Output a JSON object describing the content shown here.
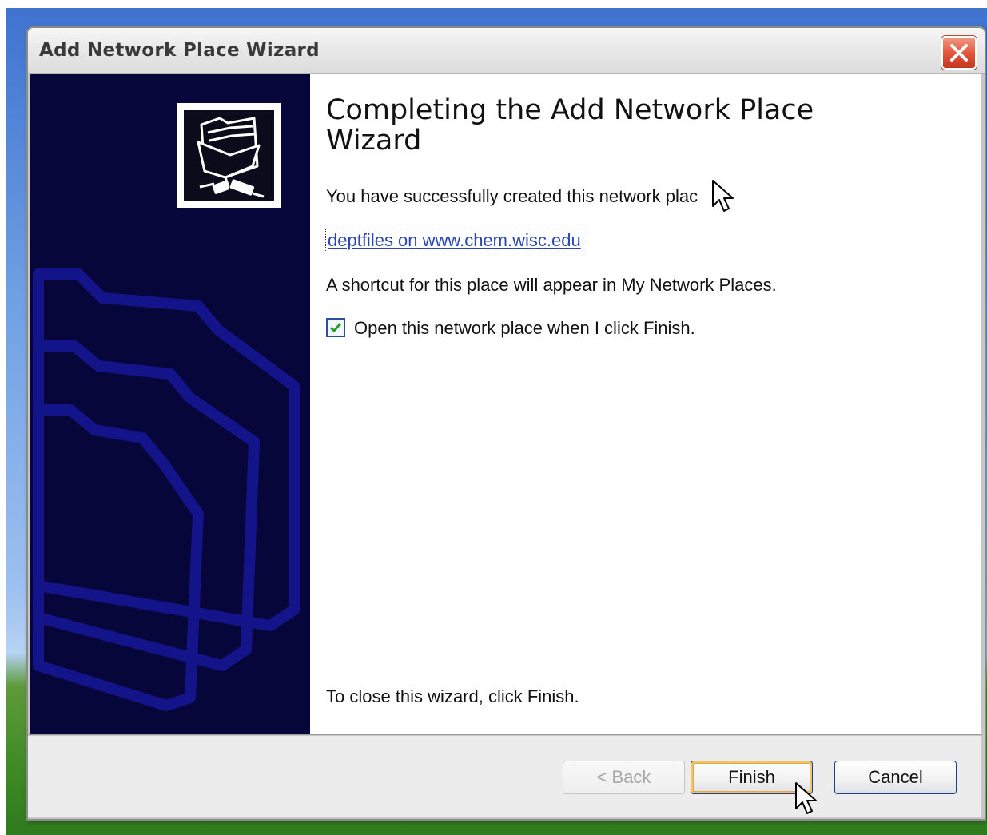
{
  "window": {
    "title": "Add Network Place Wizard"
  },
  "content": {
    "heading": "Completing the Add Network Place Wizard",
    "success_text": "You have successfully created this network plac",
    "place_link": "deptfiles on www.chem.wisc.edu",
    "shortcut_text": "A shortcut for this place will appear in My Network Places.",
    "open_checkbox": {
      "label": "Open this network place when I click Finish.",
      "checked": true
    },
    "close_instruction": "To close this wizard, click Finish."
  },
  "buttons": {
    "back": "< Back",
    "finish": "Finish",
    "cancel": "Cancel"
  },
  "colors": {
    "side_panel": "#07063b",
    "link": "#2b45b5",
    "close_button": "#e4563c"
  }
}
